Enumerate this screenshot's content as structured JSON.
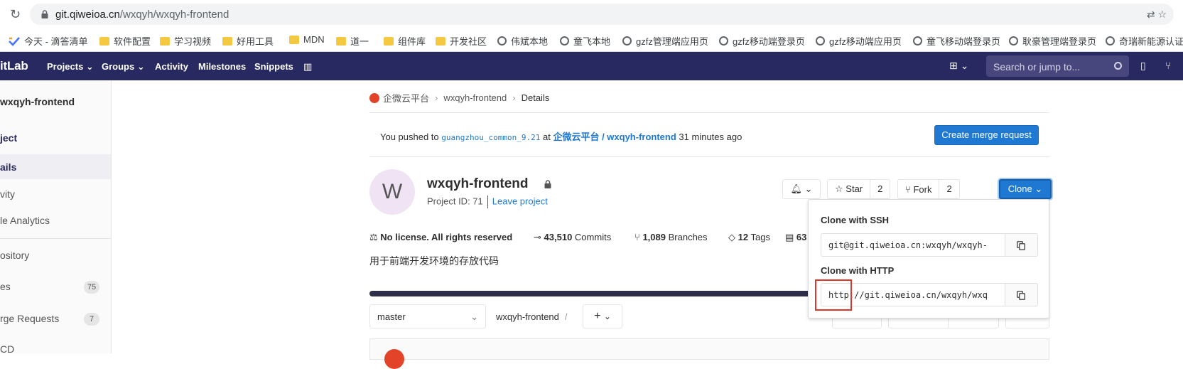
{
  "browser": {
    "url_host": "git.qiweioa.cn",
    "url_path": "/wxqyh/wxqyh-frontend"
  },
  "bookmarks": [
    {
      "label": "今天 - 滴答清单",
      "icon": "today-icon"
    },
    {
      "label": "软件配置",
      "icon": "folder-icon"
    },
    {
      "label": "学习视频",
      "icon": "folder-icon"
    },
    {
      "label": "好用工具",
      "icon": "folder-icon"
    },
    {
      "label": "MDN",
      "icon": "folder-icon"
    },
    {
      "label": "道一",
      "icon": "folder-icon"
    },
    {
      "label": "组件库",
      "icon": "folder-icon"
    },
    {
      "label": "开发社区",
      "icon": "folder-icon"
    },
    {
      "label": "伟斌本地",
      "icon": "globe-icon"
    },
    {
      "label": "童飞本地",
      "icon": "globe-icon"
    },
    {
      "label": "gzfz管理端应用页",
      "icon": "globe-icon"
    },
    {
      "label": "gzfz移动端登录页",
      "icon": "globe-icon"
    },
    {
      "label": "gzfz移动端应用页",
      "icon": "globe-icon"
    },
    {
      "label": "童飞移动端登录页",
      "icon": "globe-icon"
    },
    {
      "label": "耿豪管理端登录页",
      "icon": "globe-icon"
    },
    {
      "label": "奇瑞新能源认证",
      "icon": "globe-icon"
    }
  ],
  "header": {
    "logo": "itLab",
    "nav": [
      "Projects",
      "Groups",
      "Activity",
      "Milestones",
      "Snippets"
    ],
    "search_placeholder": "Search or jump to..."
  },
  "sidebar": {
    "title": "wxqyh-frontend",
    "items": [
      {
        "label": "ject"
      },
      {
        "label": "ails"
      },
      {
        "label": "vity"
      },
      {
        "label": "le Analytics"
      },
      {
        "label": "ository"
      },
      {
        "label": "es",
        "badge": "75"
      },
      {
        "label": "rge Requests",
        "badge": "7"
      },
      {
        "label": "CD"
      }
    ]
  },
  "breadcrumb": {
    "group": "企微云平台",
    "project": "wxqyh-frontend",
    "current": "Details"
  },
  "push_banner": {
    "prefix": "You pushed to",
    "branch": "guangzhou_common_9.21",
    "at": "at",
    "target": "企微云平台 / wxqyh-frontend",
    "time": "31 minutes ago",
    "button": "Create merge request"
  },
  "project": {
    "avatar_letter": "W",
    "name": "wxqyh-frontend",
    "id_text": "Project ID: 71",
    "leave": "Leave project",
    "star_label": "Star",
    "star_count": "2",
    "fork_label": "Fork",
    "fork_count": "2",
    "clone_label": "Clone",
    "description": "用于前端开发环境的存放代码"
  },
  "stats": {
    "license": "No license. All rights reserved",
    "commits_num": "43,510",
    "commits_label": "Commits",
    "branches_num": "1,089",
    "branches_label": "Branches",
    "tags_num": "12",
    "tags_label": "Tags",
    "size_num": "63"
  },
  "files": {
    "branch": "master",
    "path_root": "wxqyh-frontend",
    "add_label": "+"
  },
  "clone_dropdown": {
    "ssh_label": "Clone with SSH",
    "ssh_value": "git@git.qiweioa.cn:wxqyh/wxqyh-",
    "http_label": "Clone with HTTP",
    "http_value": "http://git.qiweioa.cn/wxqyh/wxq"
  },
  "colors": {
    "header_bg": "#292961",
    "accent": "#1f78d1",
    "highlight": "#e0352b"
  }
}
